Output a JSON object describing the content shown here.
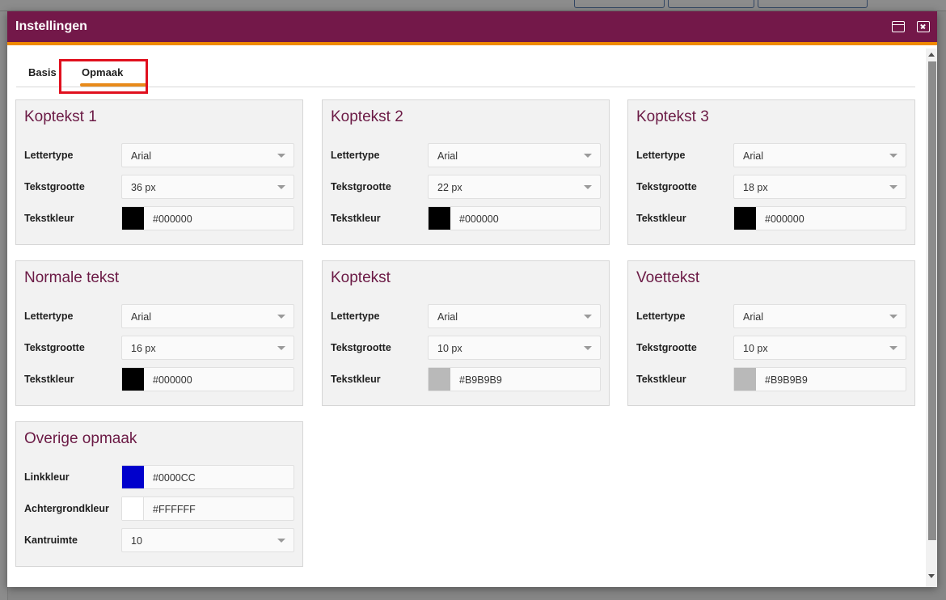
{
  "dialog": {
    "title": "Instellingen"
  },
  "tabs": [
    {
      "label": "Basis",
      "active": false
    },
    {
      "label": "Opmaak",
      "active": true
    }
  ],
  "colors": {
    "header": "#731849",
    "accent": "#F08A00",
    "card_title": "#6B1A45",
    "highlight": "#E0101E"
  },
  "cards": [
    {
      "title": "Koptekst 1",
      "font_label": "Lettertype",
      "font": "Arial",
      "size_label": "Tekstgrootte",
      "size": "36 px",
      "color_label": "Tekstkleur",
      "color": "#000000"
    },
    {
      "title": "Koptekst 2",
      "font_label": "Lettertype",
      "font": "Arial",
      "size_label": "Tekstgrootte",
      "size": "22 px",
      "color_label": "Tekstkleur",
      "color": "#000000"
    },
    {
      "title": "Koptekst 3",
      "font_label": "Lettertype",
      "font": "Arial",
      "size_label": "Tekstgrootte",
      "size": "18 px",
      "color_label": "Tekstkleur",
      "color": "#000000"
    },
    {
      "title": "Normale tekst",
      "font_label": "Lettertype",
      "font": "Arial",
      "size_label": "Tekstgrootte",
      "size": "16 px",
      "color_label": "Tekstkleur",
      "color": "#000000"
    },
    {
      "title": "Koptekst",
      "font_label": "Lettertype",
      "font": "Arial",
      "size_label": "Tekstgrootte",
      "size": "10 px",
      "color_label": "Tekstkleur",
      "color": "#B9B9B9"
    },
    {
      "title": "Voettekst",
      "font_label": "Lettertype",
      "font": "Arial",
      "size_label": "Tekstgrootte",
      "size": "10 px",
      "color_label": "Tekstkleur",
      "color": "#B9B9B9"
    }
  ],
  "overige": {
    "title": "Overige opmaak",
    "link_label": "Linkkleur",
    "link_color": "#0000CC",
    "bg_label": "Achtergrondkleur",
    "bg_color": "#FFFFFF",
    "margin_label": "Kantruimte",
    "margin_value": "10"
  },
  "icons": [
    "maximize-icon",
    "close-icon",
    "chevron-down-icon"
  ]
}
